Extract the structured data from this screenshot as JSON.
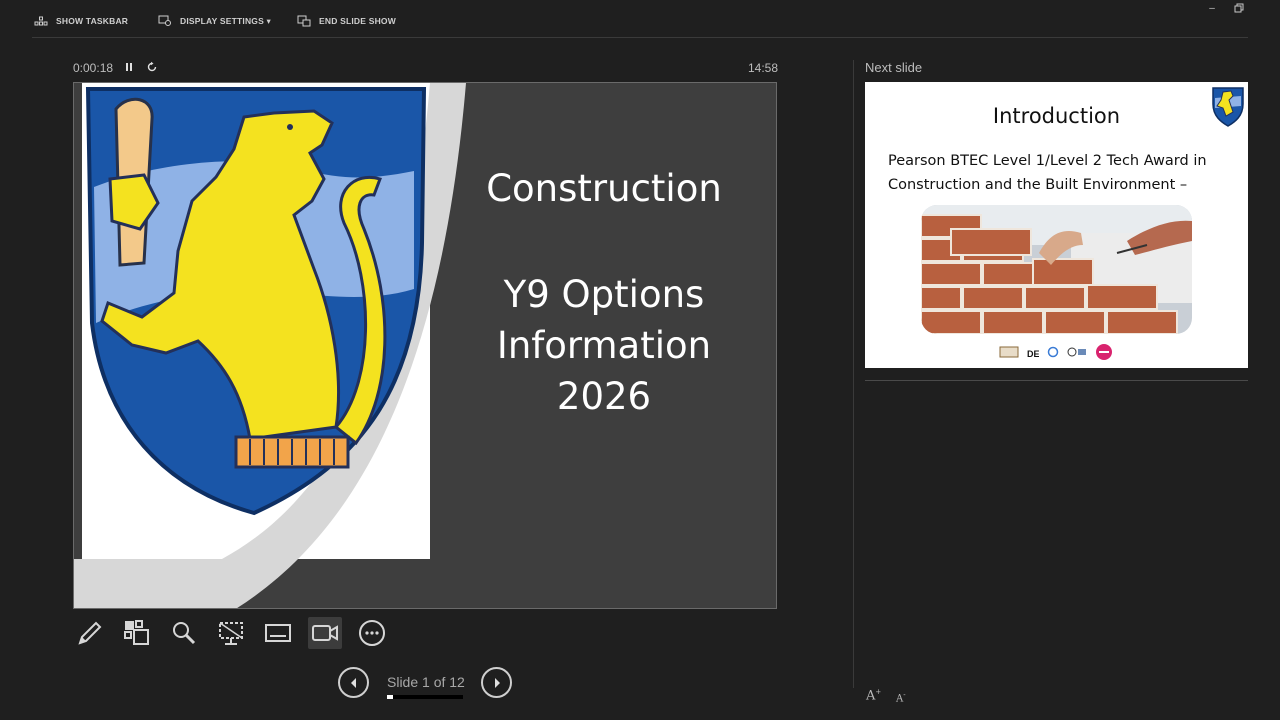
{
  "toolbar": {
    "show_taskbar": "SHOW TASKBAR",
    "display_settings": "DISPLAY SETTINGS ▾",
    "end_slide_show": "END SLIDE SHOW"
  },
  "window": {
    "minimize": "–",
    "restore": "🗗"
  },
  "presenter": {
    "elapsed": "0:00:18",
    "clock": "14:58",
    "pause_icon": "pause-icon",
    "reset_icon": "reset-icon"
  },
  "current_slide": {
    "title": "Construction",
    "line1": "Y9 Options",
    "line2": "Information",
    "line3": "2026"
  },
  "tools": [
    "pen-icon",
    "slides-grid-icon",
    "zoom-icon",
    "pointer-screen-icon",
    "subtitles-icon",
    "camera-icon",
    "more-options-icon"
  ],
  "navigation": {
    "counter": "Slide 1 of 12",
    "progress": 0.083
  },
  "next_slide": {
    "label": "Next slide",
    "title": "Introduction",
    "body_line1": "Pearson BTEC Level 1/Level 2 Tech Award in",
    "body_line2": "Construction and the Built Environment –"
  },
  "font_controls": {
    "increase": "A",
    "decrease": "A"
  },
  "colors": {
    "background": "#1f1f1f",
    "slide_bg": "#3e3e3e",
    "shield_blue": "#1a56a8",
    "lion_yellow": "#f4e21f"
  }
}
